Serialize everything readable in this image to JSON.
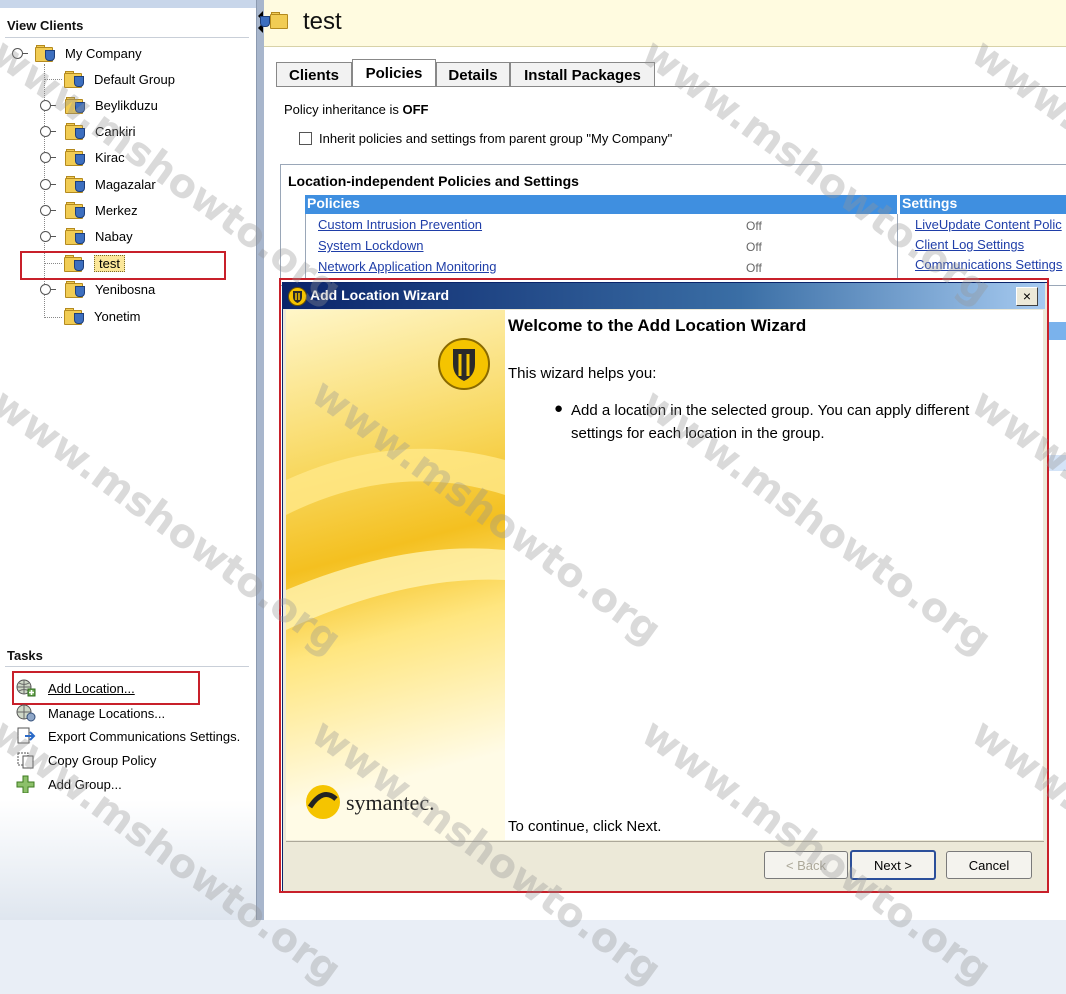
{
  "left_panel": {
    "view_clients_title": "View Clients",
    "tree": [
      {
        "label": "My Company"
      },
      {
        "label": "Default Group"
      },
      {
        "label": "Beylikduzu"
      },
      {
        "label": "Cankiri"
      },
      {
        "label": "Kirac"
      },
      {
        "label": "Magazalar"
      },
      {
        "label": "Merkez"
      },
      {
        "label": "Nabay"
      },
      {
        "label": "test"
      },
      {
        "label": "Yenibosna"
      },
      {
        "label": "Yonetim"
      }
    ],
    "tasks_title": "Tasks",
    "tasks": [
      {
        "label": "Add Location...",
        "icon": "globe-add-icon"
      },
      {
        "label": "Manage Locations...",
        "icon": "globe-gear-icon"
      },
      {
        "label": "Export Communications Settings.",
        "icon": "export-icon"
      },
      {
        "label": "Copy Group Policy",
        "icon": "copy-icon"
      },
      {
        "label": "Add Group...",
        "icon": "plus-icon"
      }
    ]
  },
  "header": {
    "title": "test"
  },
  "tabs": [
    {
      "label": "Clients"
    },
    {
      "label": "Policies",
      "active": true
    },
    {
      "label": "Details"
    },
    {
      "label": "Install Packages"
    }
  ],
  "policies": {
    "inheritance_prefix": "Policy inheritance is ",
    "inheritance_state": "OFF",
    "inherit_checkbox_label": "Inherit policies and settings from parent group \"My Company\"",
    "inherit_checked": false,
    "section_title": "Location-independent Policies and Settings",
    "policies_head": "Policies",
    "policy_rows": [
      {
        "name": "Custom Intrusion Prevention",
        "state": "Off"
      },
      {
        "name": "System Lockdown",
        "state": "Off"
      },
      {
        "name": "Network Application Monitoring",
        "state": "Off"
      }
    ],
    "settings_head": "Settings",
    "settings_rows": [
      "LiveUpdate Content Polic",
      "Client Log Settings",
      "Communications Settings"
    ]
  },
  "wizard": {
    "title": "Add Location Wizard",
    "close_glyph": "×",
    "heading": "Welcome to the Add Location Wizard",
    "intro": "This wizard helps you:",
    "bullet": "Add a location in the selected group. You can apply different settings for each location in the group.",
    "continue_text": "To continue, click Next.",
    "back_label": "< Back",
    "next_label": "Next >",
    "cancel_label": "Cancel",
    "brand": "symantec."
  },
  "watermark": "www.mshowto.org",
  "colors": {
    "highlight_red": "#c8202a",
    "header_blue": "#3f8fe0",
    "title_bar": "#0a246a",
    "link": "#1f3ea8"
  }
}
